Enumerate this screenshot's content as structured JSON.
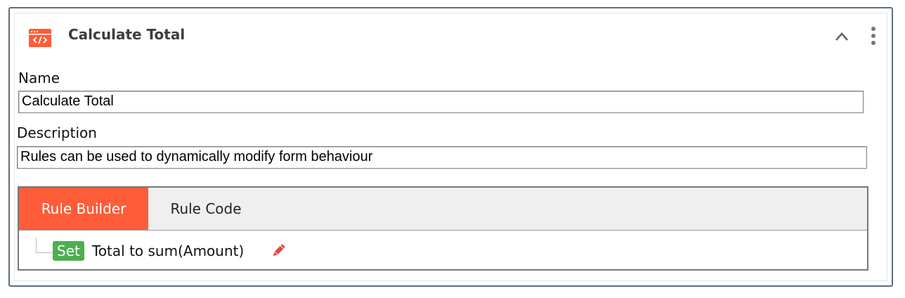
{
  "header": {
    "title": "Calculate Total",
    "icon": "code-window-icon",
    "accent_color": "#ff5c39"
  },
  "form": {
    "name_label": "Name",
    "name_value": "Calculate Total",
    "description_label": "Description",
    "description_value": "Rules can be used to dynamically modify form behaviour"
  },
  "tabs": [
    {
      "label": "Rule Builder",
      "active": true
    },
    {
      "label": "Rule Code",
      "active": false
    }
  ],
  "rule": {
    "action_badge": "Set",
    "badge_color": "#4caf50",
    "text": "Total to sum(Amount)",
    "edit_icon": "pencil-icon"
  }
}
